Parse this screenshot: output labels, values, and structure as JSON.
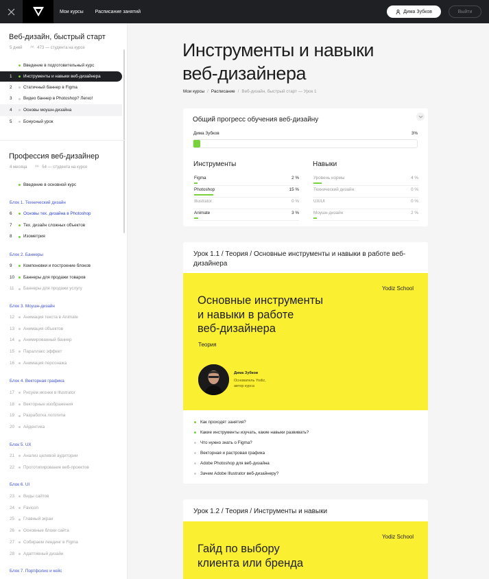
{
  "topbar": {
    "nav": [
      "Мои курсы",
      "Расписание занятий"
    ],
    "user_label": "Дима Зубков",
    "exit_label": "Выйти"
  },
  "sidebar": {
    "course1": {
      "title": "Веб-дизайн, быстрый старт",
      "duration": "5 дней",
      "students": "473 — студента на курсе",
      "intro": "Введение в подготовительный курс",
      "items": [
        {
          "num": "1",
          "label": "Инструменты и навыки веб-дизайнера"
        },
        {
          "num": "2",
          "label": "Статичный баннер в Figma"
        },
        {
          "num": "3",
          "label": "Видео баннер в Photoshop? Легко!"
        },
        {
          "num": "4",
          "label": "Основы моушн-дизайна"
        },
        {
          "num": "5",
          "label": "Бонусный урок"
        }
      ]
    },
    "course2": {
      "title": "Профессия веб-дизайнер",
      "duration": "4 месяца",
      "students": "54 — студента на курсе",
      "intro": "Введение в основной курс",
      "blocks": [
        {
          "title": "Блок 1. Технический дизайн",
          "items": [
            {
              "num": "6",
              "label": "Основы тех. дизайна в Photoshop"
            },
            {
              "num": "7",
              "label": "Тех. дизайн сложных объектов"
            },
            {
              "num": "8",
              "label": "Изометрия"
            }
          ]
        },
        {
          "title": "Блок 2. Баннеры",
          "items": [
            {
              "num": "9",
              "label": "Компоновки и построение блоков"
            },
            {
              "num": "10",
              "label": "Баннеры для продажи товаров"
            },
            {
              "num": "11",
              "label": "Баннеры для продажи услугу"
            }
          ]
        },
        {
          "title": "Блок 3. Моушн-дизайн",
          "items": [
            {
              "num": "12",
              "label": "Анимация текста в Animate"
            },
            {
              "num": "13",
              "label": "Анимация объектов"
            },
            {
              "num": "14",
              "label": "Анимированный баннер"
            },
            {
              "num": "15",
              "label": "Параллакс эффект"
            },
            {
              "num": "16",
              "label": "Анимация персонажа"
            }
          ]
        },
        {
          "title": "Блок 4. Векторная графика",
          "items": [
            {
              "num": "17",
              "label": "Рисуем иконки в Illustrator"
            },
            {
              "num": "18",
              "label": "Векторные изображения"
            },
            {
              "num": "19",
              "label": "Разработка логотипа"
            },
            {
              "num": "20",
              "label": "Айдентика"
            }
          ]
        },
        {
          "title": "Блок 5. UX",
          "items": [
            {
              "num": "21",
              "label": "Анализ целевой аудитории"
            },
            {
              "num": "22",
              "label": "Прототипирование веб-проектов"
            }
          ]
        },
        {
          "title": "Блок 6. UI",
          "items": [
            {
              "num": "23",
              "label": "Виды сайтов"
            },
            {
              "num": "24",
              "label": "Favicon"
            },
            {
              "num": "25",
              "label": "Главный экран"
            },
            {
              "num": "26",
              "label": "Основные блоки сайта"
            },
            {
              "num": "27",
              "label": "Собираем лендинг в Figma"
            },
            {
              "num": "28",
              "label": "Адаптивный дизайн"
            }
          ]
        },
        {
          "title": "Блок 7. Портфолио и кейс",
          "items": []
        }
      ]
    }
  },
  "main": {
    "title_line1": "Инструменты и навыки",
    "title_line2": "веб-дизайнера",
    "breadcrumb": [
      "Мои курсы",
      "Расписание",
      "Веб-дизайн, быстрый старт — Урок 1"
    ],
    "progress": {
      "title": "Общий прогресс обучения веб-дизайну",
      "user": "Дима Зубков",
      "percent_label": "3%",
      "percent": 3
    },
    "tools": {
      "title": "Инструменты",
      "rows": [
        {
          "name": "Figma",
          "value": "2 %",
          "fill": 0.03
        },
        {
          "name": "Photoshop",
          "value": "15 %",
          "fill": 0.18
        },
        {
          "name": "Illustrator",
          "value": "0 %",
          "fill": 0
        },
        {
          "name": "Animate",
          "value": "3 %",
          "fill": 0.04
        }
      ]
    },
    "skills": {
      "title": "Навыки",
      "rows": [
        {
          "name": "Уровень нормы",
          "value": "4 %",
          "fill": 0.08
        },
        {
          "name": "Технический дизайн",
          "value": "0 %",
          "fill": 0
        },
        {
          "name": "UX/UI",
          "value": "0 %",
          "fill": 0
        },
        {
          "name": "Моушн-дизайн",
          "value": "2 %",
          "fill": 0.03
        }
      ]
    },
    "lesson1": {
      "title": "Урок 1.1 / Теория / Основные инструменты и навыки в работе веб-дизайнера",
      "school": "Yodiz School",
      "banner_line1": "Основные инструменты",
      "banner_line2": "и навыки в работе",
      "banner_line3": "веб-дизайнера",
      "banner_sub": "Теория",
      "author_name": "Дима Зубков",
      "author_role_1": "Основатель Yodiz,",
      "author_role_2": "автор курса",
      "topics": [
        "Как проходят занятия?",
        "Какие инструменты изучать, какие навыки развивать?",
        "Что нужно знать о Figma?",
        "Векторная и растровая графика",
        "Adobe Photoshop для веб-дизайна",
        "Зачем Adobe Illustrator веб-дизайнеру?"
      ]
    },
    "lesson2": {
      "title": "Урок 1.2 / Теория / Инструменты и навыки",
      "school": "Yodiz School",
      "banner_line1": "Гайд по выбору",
      "banner_line2": "клиента или бренда"
    }
  },
  "colors": {
    "accent_green": "#7ad23b",
    "banner_yellow": "#fbef32",
    "dark": "#1f2024",
    "link_blue": "#2a3fd6"
  }
}
